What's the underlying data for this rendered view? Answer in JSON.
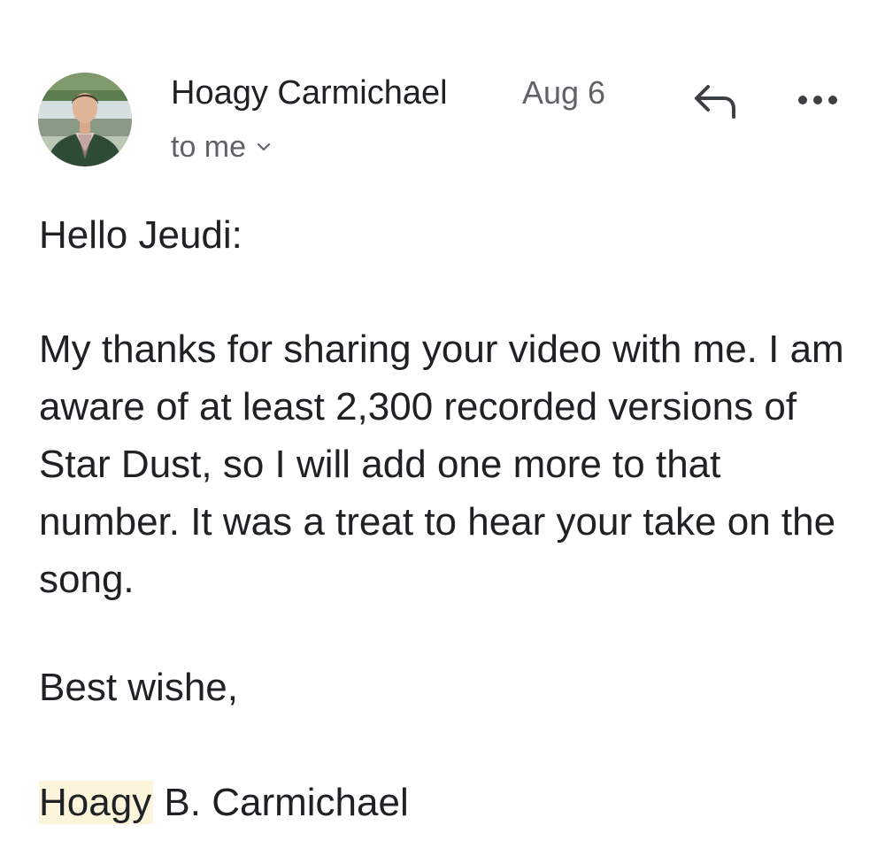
{
  "email": {
    "sender": {
      "name": "Hoagy Carmichael",
      "avatar_icon": "sender-avatar-photo"
    },
    "date": "Aug 6",
    "recipient_label": "to me",
    "actions": {
      "reply_icon": "reply-icon",
      "more_icon": "more-options-icon"
    },
    "body": {
      "greeting": "Hello Jeudi:",
      "paragraph": "My thanks for sharing your video with me. I am aware of at least 2,300 recorded versions of Star Dust, so I will add one more to that number. It was a treat to hear your take on the song.",
      "closing": "Best wishe,",
      "signature_highlighted": "Hoagy",
      "signature_rest": " B. Carmichael"
    }
  },
  "colors": {
    "text_primary": "#202124",
    "text_secondary": "#5f6368",
    "highlight": "#fcf5dc",
    "background": "#ffffff"
  }
}
